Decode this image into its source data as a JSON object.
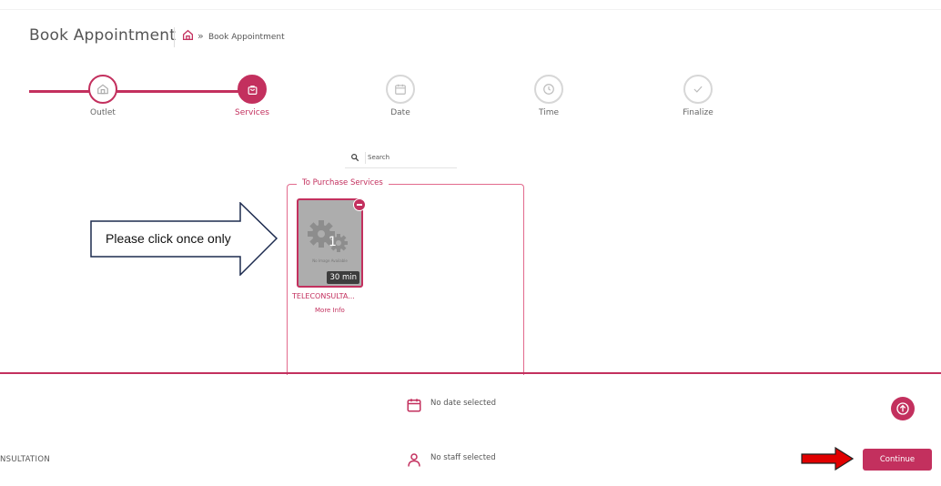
{
  "header": {
    "title": "Book Appointment",
    "breadcrumb_sep": "»",
    "breadcrumb_current": "Book Appointment"
  },
  "steps": [
    {
      "label": "Outlet",
      "icon": "store-icon",
      "state": "done"
    },
    {
      "label": "Services",
      "icon": "bag-icon",
      "state": "active"
    },
    {
      "label": "Date",
      "icon": "calendar-icon",
      "state": "pending"
    },
    {
      "label": "Time",
      "icon": "clock-icon",
      "state": "pending"
    },
    {
      "label": "Finalize",
      "icon": "check-icon",
      "state": "pending"
    }
  ],
  "search": {
    "placeholder": "Search",
    "value": ""
  },
  "services_panel": {
    "legend": "To Purchase Services",
    "items": [
      {
        "name": "TELECONSULTA...",
        "duration": "30 min",
        "quantity": "1",
        "more_info": "More Info",
        "image_text": "No Image Available"
      }
    ]
  },
  "annotation": {
    "text": "Please click once only"
  },
  "summary": {
    "date_status": "No date selected",
    "staff_status": "No staff selected",
    "selected_service_partial": "NSULTATION",
    "continue_label": "Continue"
  },
  "colors": {
    "accent": "#c3305e",
    "annotation_arrow": "#e00000",
    "pending_step": "#d7d7d7"
  }
}
